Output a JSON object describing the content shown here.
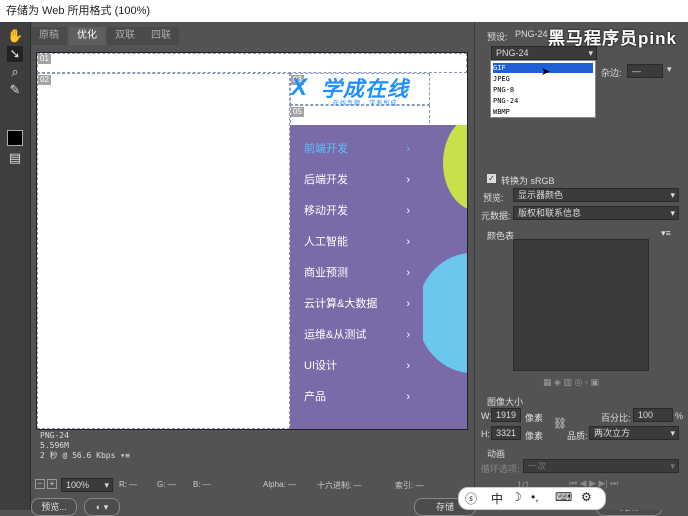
{
  "window": {
    "title": "存储为 Web 所用格式 (100%)"
  },
  "tabs": [
    "原稿",
    "优化",
    "双联",
    "四联"
  ],
  "canvas": {
    "slice_tags": [
      "01",
      "02",
      "03",
      "05"
    ],
    "logo_text": "学成在线",
    "logo_sub": "在线专题 · 学有所成",
    "menu": [
      "前端开发",
      "后端开发",
      "移动开发",
      "人工智能",
      "商业预测",
      "云计算&大数据",
      "运维&从测试",
      "UI设计",
      "产品"
    ],
    "menu_arrow": "›"
  },
  "info": {
    "format": "PNG-24",
    "size": "5.596M",
    "time": "2 秒 @ 56.6 Kbps"
  },
  "status": {
    "zoom": "100%",
    "r": "R: —",
    "g": "G: —",
    "b": "B: —",
    "alpha": "Alpha: —",
    "hex": "十六进制: —",
    "index": "索引: —"
  },
  "bottom": {
    "preview": "预览...",
    "save": "存储",
    "done": "完成"
  },
  "right": {
    "preset_label": "预设:",
    "preset_value": "PNG-24",
    "format_value": "PNG-24",
    "matte_label": "杂边:",
    "convert_srgb": "转换为 sRGB",
    "preview_label": "预览:",
    "preview_value": "显示器颜色",
    "metadata_label": "元数据:",
    "metadata_value": "版权和联系信息",
    "color_table": "颜色表",
    "image_size": "图像大小",
    "w_label": "W:",
    "w_value": "1919",
    "h_label": "H:",
    "h_value": "3321",
    "px": "像素",
    "percent_label": "百分比:",
    "percent_value": "100",
    "percent_unit": "%",
    "quality_label": "品质:",
    "quality_value": "两次立方",
    "animation": "动画",
    "loop_label": "循环选项:",
    "loop_value": "一次",
    "frame": "1/1"
  },
  "dropdown": {
    "items": [
      "GIF",
      "JPEG",
      "PNG-8",
      "PNG-24",
      "WBMP"
    ],
    "selected": 0
  },
  "watermark": "黑马程序员pink",
  "ime": {
    "label": "中"
  }
}
